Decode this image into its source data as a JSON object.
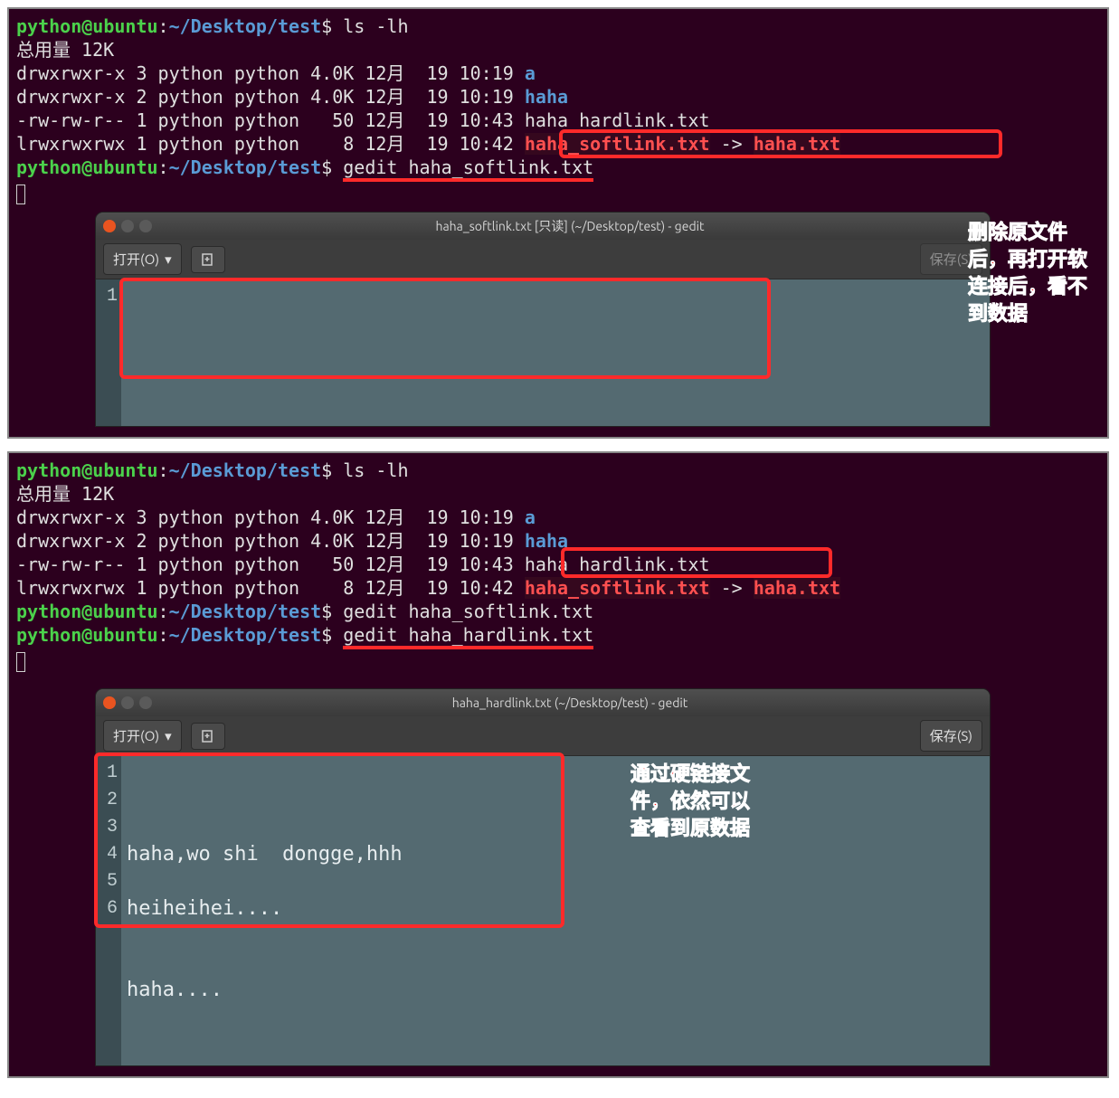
{
  "terminal1": {
    "prompt_user": "python@ubuntu",
    "prompt_colon": ":",
    "prompt_path": "~/Desktop/test",
    "prompt_sym": "$",
    "cmd_ls": "ls -lh",
    "total": "总用量 12K",
    "lines": [
      {
        "perm": "drwxrwxr-x",
        "n": "3",
        "o1": "python",
        "o2": "python",
        "size": "4.0K",
        "date": "12月  19 10:19",
        "name": "a",
        "cls": "dir-link"
      },
      {
        "perm": "drwxrwxr-x",
        "n": "2",
        "o1": "python",
        "o2": "python",
        "size": "4.0K",
        "date": "12月  19 10:19",
        "name": "haha",
        "cls": "dir-link"
      },
      {
        "perm": "-rw-rw-r--",
        "n": "1",
        "o1": "python",
        "o2": "python",
        "size": "  50",
        "date": "12月  19 10:43",
        "name": "haha_hardlink.txt",
        "cls": "white"
      },
      {
        "perm": "lrwxrwxrwx",
        "n": "1",
        "o1": "python",
        "o2": "python",
        "size": "   8",
        "date": "12月  19 10:42",
        "name": "haha_softlink.txt",
        "arrow": " -> ",
        "target": "haha.txt",
        "cls": "softlink"
      }
    ],
    "cmd_gedit": "gedit haha_softlink.txt"
  },
  "gedit1": {
    "title": "haha_softlink.txt [只读] (~/Desktop/test) - gedit",
    "open_label": "打开(O)",
    "save_label": "保存(S)",
    "line_numbers": [
      "1"
    ],
    "content": ""
  },
  "annot1": "删除原文件\n后，再打开软\n连接后，看不\n到数据",
  "terminal2": {
    "prompt_user": "python@ubuntu",
    "prompt_colon": ":",
    "prompt_path": "~/Desktop/test",
    "prompt_sym": "$",
    "cmd_ls": "ls -lh",
    "total": "总用量 12K",
    "lines": [
      {
        "perm": "drwxrwxr-x",
        "n": "3",
        "o1": "python",
        "o2": "python",
        "size": "4.0K",
        "date": "12月  19 10:19",
        "name": "a",
        "cls": "dir-link"
      },
      {
        "perm": "drwxrwxr-x",
        "n": "2",
        "o1": "python",
        "o2": "python",
        "size": "4.0K",
        "date": "12月  19 10:19",
        "name": "haha",
        "cls": "dir-link"
      },
      {
        "perm": "-rw-rw-r--",
        "n": "1",
        "o1": "python",
        "o2": "python",
        "size": "  50",
        "date": "12月  19 10:43",
        "name": "haha_hardlink.txt",
        "cls": "white"
      },
      {
        "perm": "lrwxrwxrwx",
        "n": "1",
        "o1": "python",
        "o2": "python",
        "size": "   8",
        "date": "12月  19 10:42",
        "name": "haha_softlink.txt",
        "arrow": " -> ",
        "target": "haha.txt",
        "cls": "softlink"
      }
    ],
    "cmd_gedit1": "gedit haha_softlink.txt",
    "cmd_gedit2": "gedit haha_hardlink.txt"
  },
  "gedit2": {
    "title": "haha_hardlink.txt (~/Desktop/test) - gedit",
    "open_label": "打开(O)",
    "save_label": "保存(S)",
    "line_numbers": [
      "1",
      "2",
      "3",
      "4",
      "5",
      "6"
    ],
    "content_lines": [
      "haha,wo shi  dongge,hhh",
      "",
      "heiheihei....",
      "",
      "",
      "haha...."
    ]
  },
  "annot2": "通过硬链接文\n件，依然可以\n查看到原数据"
}
